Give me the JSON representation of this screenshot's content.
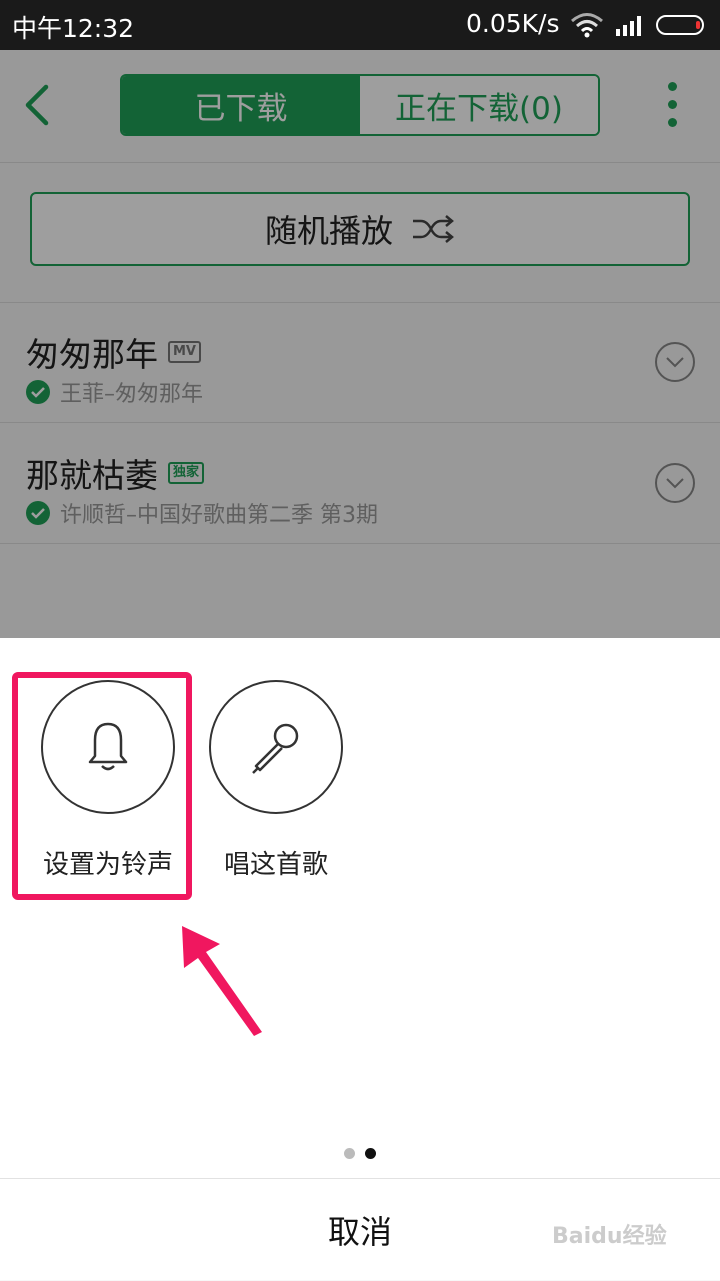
{
  "status": {
    "time": "中午12:32",
    "speed": "0.05K/s"
  },
  "header": {
    "tab_downloaded": "已下载",
    "tab_downloading": "正在下载(0)"
  },
  "shuffle": {
    "label": "随机播放"
  },
  "songs": [
    {
      "title": "匆匆那年",
      "badge": "MV",
      "subtitle": "王菲–匆匆那年"
    },
    {
      "title": "那就枯萎",
      "badge": "独家",
      "subtitle": "许顺哲–中国好歌曲第二季 第3期"
    }
  ],
  "sheet": {
    "actions": [
      {
        "label": "设置为铃声",
        "icon": "bell-icon"
      },
      {
        "label": "唱这首歌",
        "icon": "microphone-icon"
      }
    ],
    "page_count": 2,
    "active_page": 2,
    "cancel": "取消"
  },
  "colors": {
    "accent": "#1fa158",
    "highlight": "#f0175f"
  },
  "watermark": "Baidu经验"
}
